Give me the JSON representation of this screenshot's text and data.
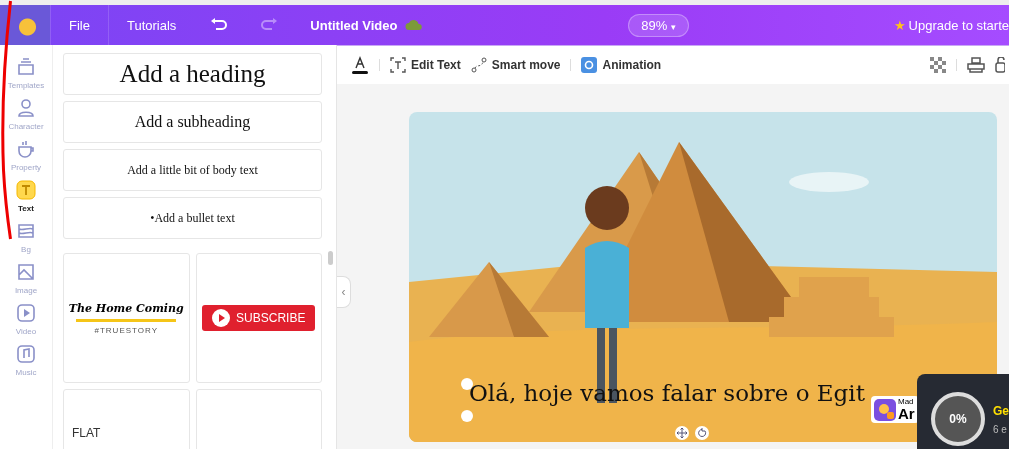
{
  "topbar": {
    "menu": [
      "File",
      "Tutorials"
    ],
    "title": "Untitled Video",
    "zoom": "89%",
    "zoom_caret": "▾",
    "star": "★",
    "upgrade": "Upgrade to starte"
  },
  "collapse": "‹",
  "rail": [
    {
      "label": "Templates",
      "kind": "templates",
      "selected": false
    },
    {
      "label": "Character",
      "kind": "character",
      "selected": false
    },
    {
      "label": "Property",
      "kind": "property",
      "selected": false
    },
    {
      "label": "Text",
      "kind": "text",
      "selected": true
    },
    {
      "label": "Bg",
      "kind": "bg",
      "selected": false
    },
    {
      "label": "Image",
      "kind": "image",
      "selected": false
    },
    {
      "label": "Video",
      "kind": "video",
      "selected": false
    },
    {
      "label": "Music",
      "kind": "music",
      "selected": false
    }
  ],
  "presets": [
    {
      "kind": "heading",
      "label": "Add a heading"
    },
    {
      "kind": "subheading",
      "label": "Add a subheading"
    },
    {
      "kind": "body",
      "label": "Add a little bit of body text"
    },
    {
      "kind": "bullet",
      "label": "Add a bullet text",
      "bullet": "•"
    }
  ],
  "templates": [
    {
      "kind": "title",
      "title": "The Home Coming",
      "tag": "#TRUESTORY"
    },
    {
      "kind": "subscribe",
      "title": "SUBSCRIBE"
    },
    {
      "kind": "flat",
      "title": "FLAT"
    },
    {
      "kind": "blank"
    }
  ],
  "toolbar": [
    "Edit Text",
    "Smart move",
    "Animation"
  ],
  "scene": {
    "caption": "Olá, hoje vamos falar sobre o Egit",
    "badge_small": "Mad",
    "badge": "Ar"
  },
  "popup": {
    "percent": "0%",
    "title": "Ge",
    "subtitle": "6 e"
  }
}
